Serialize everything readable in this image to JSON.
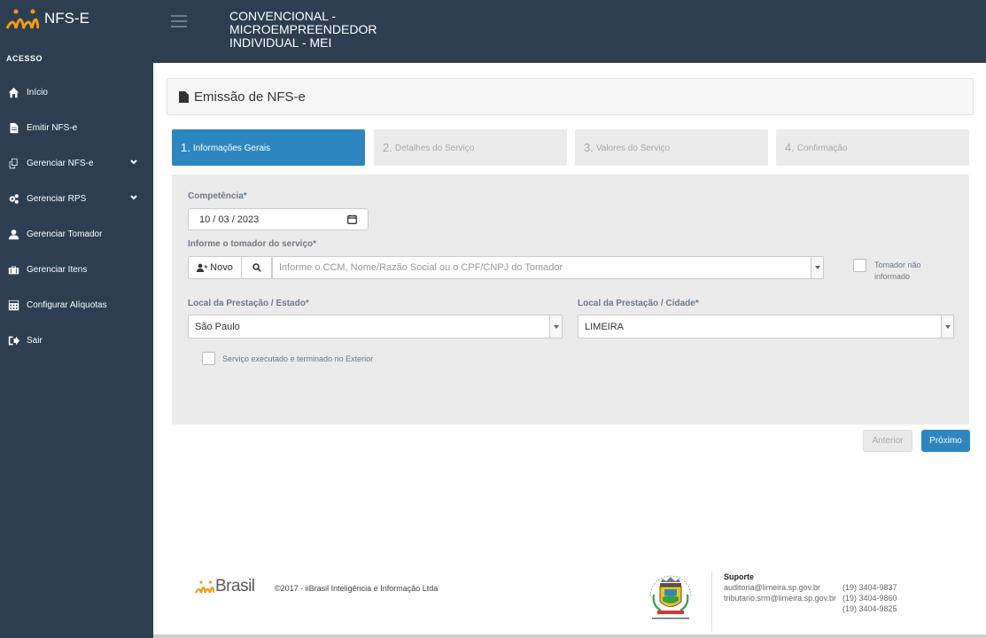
{
  "brand": {
    "name": "NFS-E"
  },
  "sidebar": {
    "section": "ACESSO",
    "items": [
      {
        "label": "Início",
        "icon": "home-icon"
      },
      {
        "label": "Emitir NFS-e",
        "icon": "file-icon"
      },
      {
        "label": "Gerenciar NFS-e",
        "icon": "copy-icon",
        "expandable": true
      },
      {
        "label": "Gerenciar RPS",
        "icon": "gears-icon",
        "expandable": true
      },
      {
        "label": "Gerenciar Tomador",
        "icon": "user-icon"
      },
      {
        "label": "Gerenciar Itens",
        "icon": "briefcase-icon"
      },
      {
        "label": "Configurar Alíquotas",
        "icon": "calculator-icon"
      },
      {
        "label": "Sair",
        "icon": "sign-out-icon"
      }
    ]
  },
  "header": {
    "title_line1": "CONVENCIONAL -",
    "title_line2": "MICROEMPREENDEDOR",
    "title_line3": "INDIVIDUAL - MEI"
  },
  "panel": {
    "title": "Emissão de NFS-e"
  },
  "steps": [
    {
      "num": "1.",
      "label": "Informações Gerais",
      "active": true
    },
    {
      "num": "2.",
      "label": "Detalhes do Serviço",
      "active": false
    },
    {
      "num": "3.",
      "label": "Valores do Serviço",
      "active": false
    },
    {
      "num": "4.",
      "label": "Confirmação",
      "active": false
    }
  ],
  "form": {
    "competencia_label": "Competência*",
    "competencia_value": "10 / 03 / 2023",
    "tomador_label": "Informe o tomador do serviço*",
    "novo_label": "Novo",
    "tomador_placeholder": "Informe o CCM, Nome/Razão Social ou o CPF/CNPJ do Tomador",
    "tomador_nao_informado_l1": "Tomador não",
    "tomador_nao_informado_l2": "informado",
    "estado_label": "Local da Prestação / Estado*",
    "estado_value": "São Paulo",
    "cidade_label": "Local da Prestação / Cidade*",
    "cidade_value": "LIMEIRA",
    "exterior_label": "Serviço executado e terminado no Exterior"
  },
  "actions": {
    "anterior": "Anterior",
    "proximo": "Próximo"
  },
  "footer": {
    "brand": "Brasil",
    "copyright": "©2017 - iiBrasil Inteligência e Informação Ltda",
    "support_title": "Suporte",
    "support_email1": "auditoria@limeira.sp.gov.br",
    "support_phone1": "(19) 3404-9837",
    "support_email2": "tributario.srm@limeira.sp.gov.br",
    "support_phone2": "(19) 3404-9860",
    "support_phone3": "(19) 3404-9825"
  },
  "colors": {
    "sidebar_bg": "#2c3e50",
    "accent": "#2e86c1",
    "logo_orange": "#f39c12"
  }
}
